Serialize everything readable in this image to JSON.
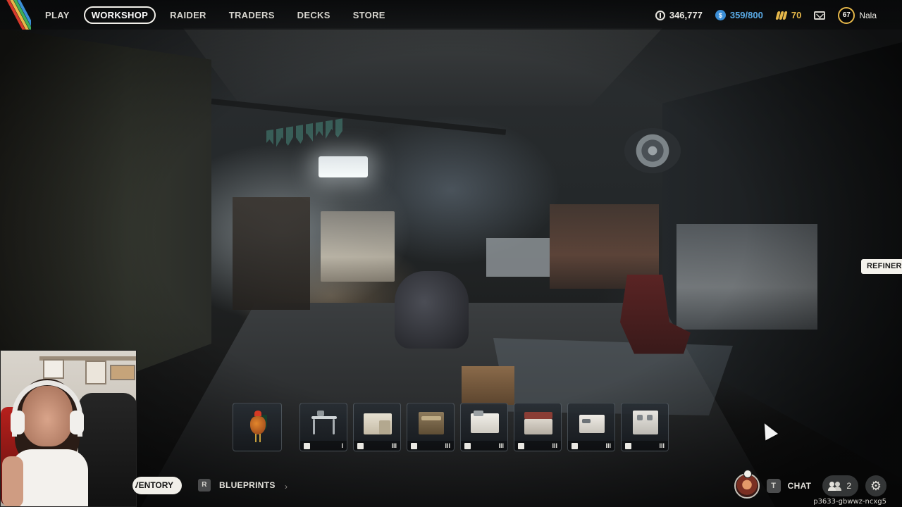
{
  "nav": {
    "items": [
      {
        "label": "PLAY",
        "active": false
      },
      {
        "label": "WORKSHOP",
        "active": true
      },
      {
        "label": "RAIDER",
        "active": false
      },
      {
        "label": "TRADERS",
        "active": false
      },
      {
        "label": "DECKS",
        "active": false
      },
      {
        "label": "STORE",
        "active": false
      }
    ]
  },
  "currency": {
    "coins": "346,777",
    "cred": "359/800",
    "raider_tokens": "70"
  },
  "profile": {
    "level": "67",
    "name": "Nala"
  },
  "scene": {
    "refiner_label": "REFINER"
  },
  "stations": [
    {
      "name": "rooster",
      "icon": "rooster-icon",
      "tier": ""
    },
    {
      "name": "workbench-basic",
      "icon": "bench-icon",
      "tier": "I"
    },
    {
      "name": "medical-lab",
      "icon": "plus-icon",
      "tier": "III"
    },
    {
      "name": "explosives-station",
      "icon": "explosive-icon",
      "tier": "III"
    },
    {
      "name": "gear-bench",
      "icon": "shield-icon",
      "tier": "III"
    },
    {
      "name": "utility-station",
      "icon": "utility-icon",
      "tier": "III"
    },
    {
      "name": "gunsmith",
      "icon": "crossed-guns-icon",
      "tier": "III"
    },
    {
      "name": "refiner",
      "icon": "refiner-icon",
      "tier": "III"
    }
  ],
  "bottom": {
    "inventory_label": "INVENTORY",
    "blueprints_key": "R",
    "blueprints_label": "BLUEPRINTS",
    "chat_key": "T",
    "chat_label": "CHAT",
    "party_count": "2",
    "session_id": "p3633-gbwwz-ncxg5"
  },
  "colors": {
    "accent_gold": "#e6b84a",
    "cred_blue": "#3b8ed6"
  }
}
